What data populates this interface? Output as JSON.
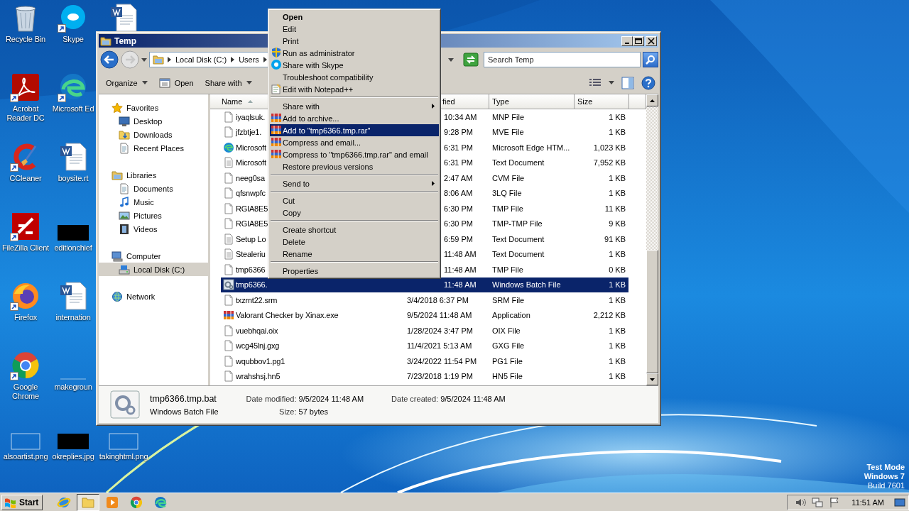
{
  "desktop": {
    "icons": [
      [
        {
          "label": "Recycle Bin",
          "shortcut": false
        },
        {
          "label": "Acrobat Reader DC",
          "shortcut": true
        },
        {
          "label": "CCleaner",
          "shortcut": true
        },
        {
          "label": "FileZilla Client",
          "shortcut": true
        },
        {
          "label": "Firefox",
          "shortcut": true
        },
        {
          "label": "Google Chrome",
          "shortcut": true
        },
        {
          "label": "alsoartist.png",
          "shortcut": false
        }
      ],
      [
        {
          "label": "Skype",
          "shortcut": true
        },
        {
          "label": "Microsoft Ed",
          "shortcut": true
        },
        {
          "label": "boysite.rt",
          "shortcut": false
        },
        {
          "label": "editionchief",
          "shortcut": false
        },
        {
          "label": "internation",
          "shortcut": false
        },
        {
          "label": "makegroun",
          "shortcut": false
        },
        {
          "label": "okreplies.jpg",
          "shortcut": false
        }
      ],
      [
        {
          "shortcut": false
        },
        {
          "label": "takinghtml.png",
          "shortcut": false
        }
      ]
    ],
    "test_mode": [
      "Test Mode",
      "Windows 7",
      "Build 7601"
    ]
  },
  "explorer": {
    "title": "Temp",
    "breadcrumbs": [
      "Local Disk (C:)",
      "Users"
    ],
    "search": {
      "placeholder": "Search Temp"
    },
    "toolbar": [
      {
        "label": "Organize",
        "dropdown": true
      },
      {
        "label": "Open",
        "dropdown": false
      },
      {
        "label": "Share with",
        "dropdown": true
      }
    ],
    "nav": [
      {
        "label": "Favorites",
        "selected": false,
        "children": [
          {
            "label": "Desktop",
            "selected": false
          },
          {
            "label": "Downloads",
            "selected": false
          },
          {
            "label": "Recent Places",
            "selected": false
          }
        ]
      },
      {
        "label": "Libraries",
        "selected": false,
        "children": [
          {
            "label": "Documents",
            "selected": false
          },
          {
            "label": "Music",
            "selected": false
          },
          {
            "label": "Pictures",
            "selected": false
          },
          {
            "label": "Videos",
            "selected": false
          }
        ]
      },
      {
        "label": "Computer",
        "selected": false,
        "children": [
          {
            "label": "Local Disk (C:)",
            "selected": true
          }
        ]
      },
      {
        "label": "Network",
        "selected": false
      }
    ],
    "columns": [
      {
        "label": "Name",
        "sorted": true,
        "partly_hidden": false
      },
      {
        "label": "fied",
        "sorted": false,
        "partly_hidden": true
      },
      {
        "label": "Type",
        "sorted": false,
        "partly_hidden": false
      },
      {
        "label": "Size",
        "sorted": false,
        "partly_hidden": false
      }
    ],
    "rows": [
      {
        "name": "iyaqlsuk.",
        "date": "10:34 AM",
        "type": "MNP File",
        "size": "1 KB",
        "selected": false,
        "partly_hidden": true
      },
      {
        "name": "jfzbtje1.",
        "date": "9:28 PM",
        "type": "MVE File",
        "size": "1 KB",
        "selected": false,
        "partly_hidden": true
      },
      {
        "name": "Microsoft",
        "date": "6:31 PM",
        "type": "Microsoft Edge HTM...",
        "size": "1,023 KB",
        "selected": false,
        "partly_hidden": true
      },
      {
        "name": "Microsoft",
        "date": "6:31 PM",
        "type": "Text Document",
        "size": "7,952 KB",
        "selected": false,
        "partly_hidden": true
      },
      {
        "name": "neeg0sa",
        "date": "2:47 AM",
        "type": "CVM File",
        "size": "1 KB",
        "selected": false,
        "partly_hidden": true
      },
      {
        "name": "qfsnwpfc",
        "date": "8:06 AM",
        "type": "3LQ File",
        "size": "1 KB",
        "selected": false,
        "partly_hidden": true
      },
      {
        "name": "RGIA8E5",
        "date": "6:30 PM",
        "type": "TMP File",
        "size": "11 KB",
        "selected": false,
        "partly_hidden": true
      },
      {
        "name": "RGIA8E5",
        "date": "6:30 PM",
        "type": "TMP-TMP File",
        "size": "9 KB",
        "selected": false,
        "partly_hidden": true
      },
      {
        "name": "Setup Lo",
        "date": "6:59 PM",
        "type": "Text Document",
        "size": "91 KB",
        "selected": false,
        "partly_hidden": true
      },
      {
        "name": "Stealeriu",
        "date": "11:48 AM",
        "type": "Text Document",
        "size": "1 KB",
        "selected": false,
        "partly_hidden": true
      },
      {
        "name": "tmp6366",
        "date": "11:48 AM",
        "type": "TMP File",
        "size": "0 KB",
        "selected": false,
        "partly_hidden": true
      },
      {
        "name": "tmp6366.",
        "date": "11:48 AM",
        "type": "Windows Batch File",
        "size": "1 KB",
        "selected": true,
        "partly_hidden": true
      },
      {
        "name": "txzrnt22.srm",
        "date": "3/4/2018 6:37 PM",
        "type": "SRM File",
        "size": "1 KB",
        "selected": false,
        "partly_hidden": false
      },
      {
        "name": "Valorant Checker by Xinax.exe",
        "date": "9/5/2024 11:48 AM",
        "type": "Application",
        "size": "2,212 KB",
        "selected": false,
        "partly_hidden": false
      },
      {
        "name": "vuebhqai.oix",
        "date": "1/28/2024 3:47 PM",
        "type": "OIX File",
        "size": "1 KB",
        "selected": false,
        "partly_hidden": false
      },
      {
        "name": "wcg45lnj.gxg",
        "date": "11/4/2021 5:13 AM",
        "type": "GXG File",
        "size": "1 KB",
        "selected": false,
        "partly_hidden": false
      },
      {
        "name": "wqubbov1.pg1",
        "date": "3/24/2022 11:54 PM",
        "type": "PG1 File",
        "size": "1 KB",
        "selected": false,
        "partly_hidden": false
      },
      {
        "name": "wrahshsj.hn5",
        "date": "7/23/2018 1:19 PM",
        "type": "HN5 File",
        "size": "1 KB",
        "selected": false,
        "partly_hidden": false
      }
    ],
    "details": {
      "name": "tmp6366.tmp.bat",
      "type": "Windows Batch File",
      "fields": [
        {
          "label": "Date modified:",
          "value": "9/5/2024 11:48 AM"
        },
        {
          "label": "Size:",
          "value": "57 bytes"
        },
        {
          "label": "Date created:",
          "value": "9/5/2024 11:48 AM"
        }
      ]
    }
  },
  "context_menu": [
    {
      "kind": "item",
      "label": "Open",
      "default": true,
      "submenu": false,
      "selected": false
    },
    {
      "kind": "item",
      "label": "Edit",
      "default": false,
      "submenu": false,
      "selected": false
    },
    {
      "kind": "item",
      "label": "Print",
      "default": false,
      "submenu": false,
      "selected": false
    },
    {
      "kind": "item",
      "label": "Run as administrator",
      "default": false,
      "submenu": false,
      "selected": false
    },
    {
      "kind": "item",
      "label": "Share with Skype",
      "default": false,
      "submenu": false,
      "selected": false
    },
    {
      "kind": "item",
      "label": "Troubleshoot compatibility",
      "default": false,
      "submenu": false,
      "selected": false
    },
    {
      "kind": "item",
      "label": "Edit with Notepad++",
      "default": false,
      "submenu": false,
      "selected": false
    },
    {
      "kind": "separator"
    },
    {
      "kind": "item",
      "label": "Share with",
      "default": false,
      "submenu": true,
      "selected": false
    },
    {
      "kind": "item",
      "label": "Add to archive...",
      "default": false,
      "submenu": false,
      "selected": false
    },
    {
      "kind": "item",
      "label": "Add to \"tmp6366.tmp.rar\"",
      "default": false,
      "submenu": false,
      "selected": true
    },
    {
      "kind": "item",
      "label": "Compress and email...",
      "default": false,
      "submenu": false,
      "selected": false
    },
    {
      "kind": "item",
      "label": "Compress to \"tmp6366.tmp.rar\" and email",
      "default": false,
      "submenu": false,
      "selected": false
    },
    {
      "kind": "item",
      "label": "Restore previous versions",
      "default": false,
      "submenu": false,
      "selected": false
    },
    {
      "kind": "separator"
    },
    {
      "kind": "item",
      "label": "Send to",
      "default": false,
      "submenu": true,
      "selected": false
    },
    {
      "kind": "separator"
    },
    {
      "kind": "item",
      "label": "Cut",
      "default": false,
      "submenu": false,
      "selected": false
    },
    {
      "kind": "item",
      "label": "Copy",
      "default": false,
      "submenu": false,
      "selected": false
    },
    {
      "kind": "separator"
    },
    {
      "kind": "item",
      "label": "Create shortcut",
      "default": false,
      "submenu": false,
      "selected": false
    },
    {
      "kind": "item",
      "label": "Delete",
      "default": false,
      "submenu": false,
      "selected": false
    },
    {
      "kind": "item",
      "label": "Rename",
      "default": false,
      "submenu": false,
      "selected": false
    },
    {
      "kind": "separator"
    },
    {
      "kind": "item",
      "label": "Properties",
      "default": false,
      "submenu": false,
      "selected": false
    }
  ],
  "taskbar": {
    "start": "Start",
    "apps": [
      {
        "selected": false
      },
      {
        "selected": true
      },
      {
        "selected": false
      },
      {
        "selected": false
      },
      {
        "selected": false
      }
    ],
    "clock": "11:51 AM"
  }
}
